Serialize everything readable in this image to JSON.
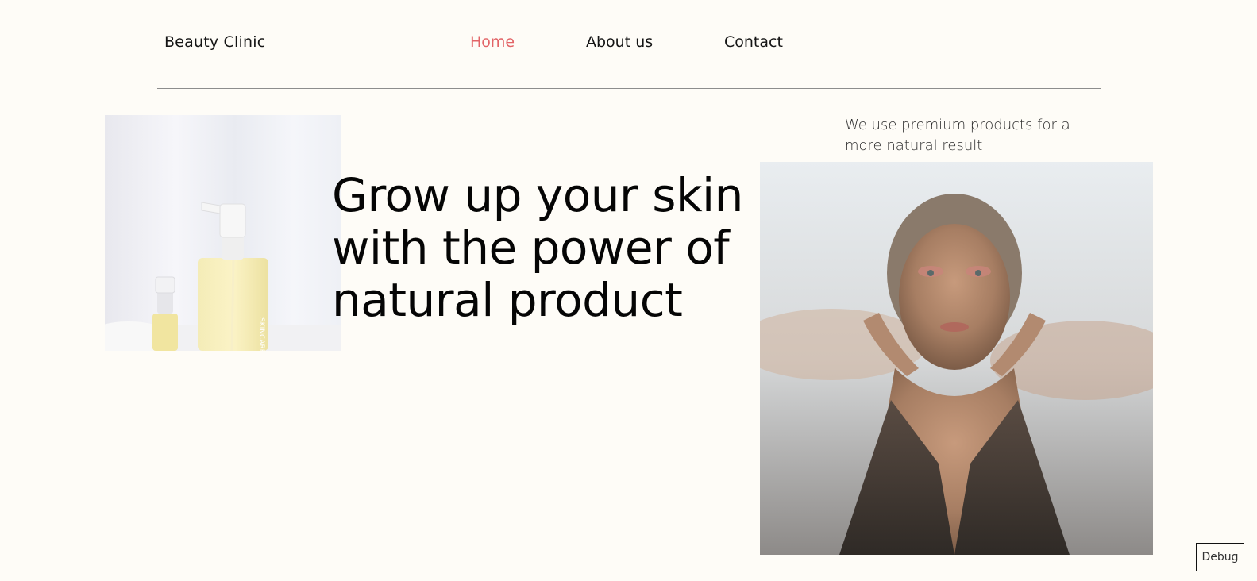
{
  "header": {
    "brand": "Beauty Clinic",
    "nav": [
      {
        "label": "Home",
        "active": true
      },
      {
        "label": "About us",
        "active": false
      },
      {
        "label": "Contact",
        "active": false
      }
    ]
  },
  "hero": {
    "lines": [
      "Grow up your skin",
      "with the power of",
      "natural product"
    ]
  },
  "tagline": "We use premium products for a more natural result",
  "images": {
    "product": "skincare-bottles-photo",
    "portrait": "woman-portrait-photo"
  },
  "debug": {
    "label": "Debug"
  },
  "colors": {
    "background": "#fefcf7",
    "accent": "#e26467",
    "text": "#141414"
  }
}
